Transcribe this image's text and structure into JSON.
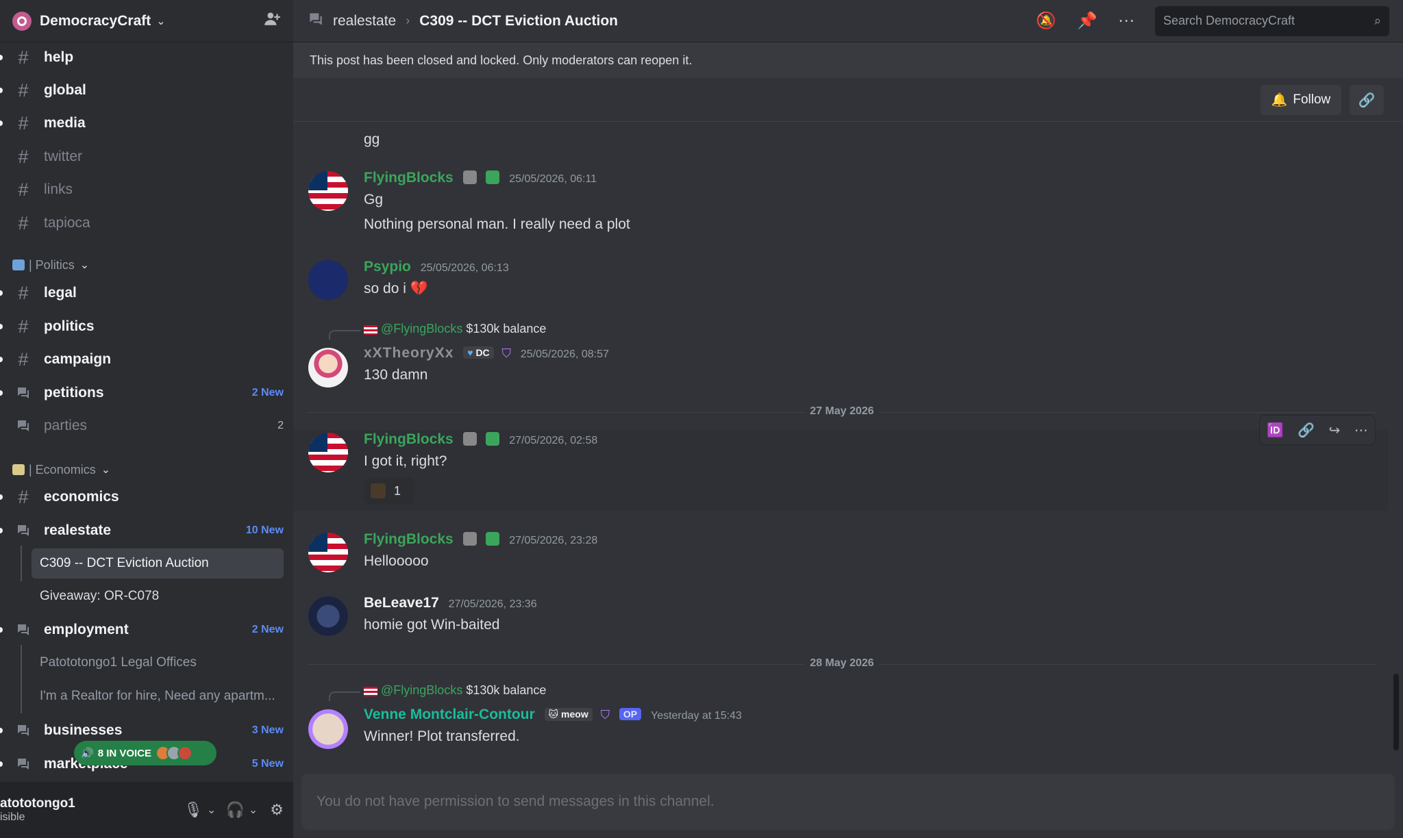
{
  "server": {
    "name": "DemocracyCraft"
  },
  "sidebar": {
    "channels": [
      {
        "name": "help",
        "kind": "text",
        "state": "unread"
      },
      {
        "name": "global",
        "kind": "text",
        "state": "unread"
      },
      {
        "name": "media",
        "kind": "text",
        "state": "unread"
      },
      {
        "name": "twitter",
        "kind": "text",
        "state": "muted"
      },
      {
        "name": "links",
        "kind": "text",
        "state": "muted"
      },
      {
        "name": "tapioca",
        "kind": "text",
        "state": "muted"
      }
    ],
    "category_politics": "| Politics",
    "politics": [
      {
        "name": "legal",
        "kind": "text"
      },
      {
        "name": "politics",
        "kind": "text"
      },
      {
        "name": "campaign",
        "kind": "text"
      },
      {
        "name": "petitions",
        "kind": "forum",
        "badge": "2 New"
      },
      {
        "name": "parties",
        "kind": "forum",
        "count": "2"
      }
    ],
    "category_economics": "| Economics",
    "economics": [
      {
        "name": "economics",
        "kind": "text"
      },
      {
        "name": "realestate",
        "kind": "forum",
        "badge": "10 New"
      },
      {
        "name": "employment",
        "kind": "forum",
        "badge": "2 New"
      },
      {
        "name": "businesses",
        "kind": "forum",
        "badge": "3 New"
      },
      {
        "name": "marketplace",
        "kind": "forum",
        "badge": "5 New"
      }
    ],
    "threads_realestate": [
      "C309 -- DCT Eviction Auction",
      "Giveaway: OR-C078"
    ],
    "threads_employment": [
      "Patototongo1 Legal Offices",
      "I'm a Realtor for hire, Need any apartm..."
    ],
    "voice_pill": "8 IN VOICE"
  },
  "user": {
    "name": "atototongo1",
    "status": "isible"
  },
  "topbar": {
    "channel": "realestate",
    "thread": "C309 -- DCT Eviction Auction",
    "search_placeholder": "Search DemocracyCraft"
  },
  "banner": "This post has been closed and locked. Only moderators can reopen it.",
  "follow_label": "Follow",
  "messages": {
    "m0": {
      "text": "gg"
    },
    "m1": {
      "author": "FlyingBlocks",
      "time": "25/05/2026, 06:11",
      "lines": [
        "Gg",
        "Nothing personal man. I really need a plot"
      ]
    },
    "m2": {
      "author": "Psypio",
      "time": "25/05/2026, 06:13",
      "text": "so do i"
    },
    "m3": {
      "reply_to": "@FlyingBlocks",
      "reply_text": "$130k balance",
      "author": "xXTheoryXx",
      "tag": "DC",
      "time": "25/05/2026, 08:57",
      "text": "130 damn"
    },
    "divider1": "27 May 2026",
    "m4": {
      "author": "FlyingBlocks",
      "time": "27/05/2026, 02:58",
      "text": "I got it, right?",
      "reaction_count": "1"
    },
    "m5": {
      "author": "FlyingBlocks",
      "time": "27/05/2026, 23:28",
      "text": "Hellooooo"
    },
    "m6": {
      "author": "BeLeave17",
      "time": "27/05/2026, 23:36",
      "text": "homie got Win-baited"
    },
    "divider2": "28 May 2026",
    "m7": {
      "reply_to": "@FlyingBlocks",
      "reply_text": "$130k balance",
      "author": "Venne Montclair-Contour",
      "tag": "meow",
      "op": "OP",
      "time": "Yesterday at 15:43",
      "text": "Winner! Plot transferred."
    }
  },
  "composer_placeholder": "You do not have permission to send messages in this channel.",
  "colors": {
    "accent": "#5865f2",
    "green": "#3ba55c",
    "teal": "#1abc9c",
    "badge": "#5d8bf4"
  }
}
